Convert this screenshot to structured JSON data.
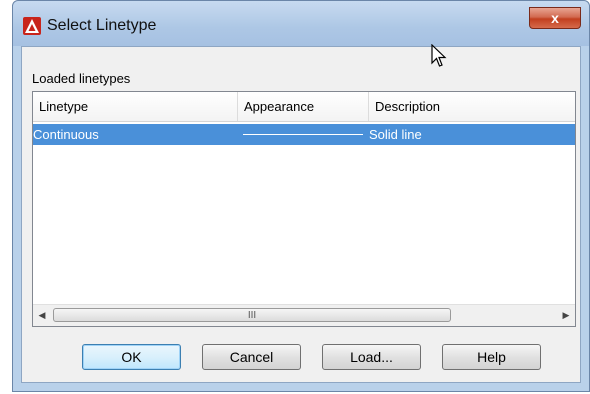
{
  "window": {
    "title": "Select Linetype",
    "close_label": "x"
  },
  "group": {
    "label": "Loaded linetypes"
  },
  "table": {
    "columns": [
      "Linetype",
      "Appearance",
      "Description"
    ],
    "rows": [
      {
        "linetype": "Continuous",
        "appearance": "solid-line-sample",
        "description": "Solid line",
        "selected": true
      }
    ]
  },
  "scrollbar": {
    "left_arrow": "◀",
    "right_arrow": "▶",
    "grip": "III"
  },
  "buttons": {
    "ok": "OK",
    "cancel": "Cancel",
    "load": "Load...",
    "help": "Help"
  },
  "colors": {
    "selection": "#4a90d9",
    "app_icon": "#c8241b"
  },
  "icons": {
    "app": "autocad-logo-icon",
    "cursor": "mouse-pointer-icon"
  }
}
